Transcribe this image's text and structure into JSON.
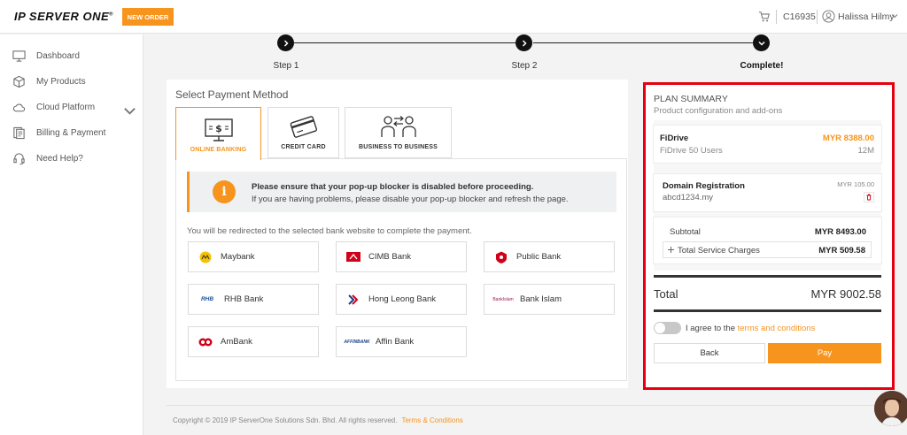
{
  "header": {
    "logo": "IP SERVER ONE",
    "logo_mark": "®",
    "new_order_label": "NEW ORDER",
    "client_id": "C16935",
    "user_name": "Halissa Hilmy"
  },
  "sidebar": {
    "items": [
      {
        "label": "Dashboard",
        "icon": "monitor-icon"
      },
      {
        "label": "My Products",
        "icon": "box-icon"
      },
      {
        "label": "Cloud Platform",
        "icon": "cloud-icon"
      },
      {
        "label": "Billing & Payment",
        "icon": "billing-icon"
      },
      {
        "label": "Need Help?",
        "icon": "headset-icon"
      }
    ]
  },
  "stepper": {
    "steps": [
      {
        "label": "Step 1"
      },
      {
        "label": "Step 2"
      },
      {
        "label": "Complete!"
      }
    ]
  },
  "payment": {
    "title": "Select Payment Method",
    "tabs": [
      {
        "label": "ONLINE BANKING",
        "active": true
      },
      {
        "label": "CREDIT CARD",
        "active": false
      },
      {
        "label": "BUSINESS TO BUSINESS",
        "active": false
      }
    ],
    "notice_title": "Please ensure that your pop-up blocker is disabled before proceeding.",
    "notice_body": "If you are having problems, please disable your pop-up blocker and refresh the page.",
    "redirect_text": "You will be redirected to the selected bank website to complete the payment.",
    "banks": [
      {
        "name": "Maybank",
        "logo_text": ""
      },
      {
        "name": "CIMB Bank",
        "logo_text": ""
      },
      {
        "name": "Public Bank",
        "logo_text": ""
      },
      {
        "name": "RHB Bank",
        "logo_text": "RHB"
      },
      {
        "name": "Hong Leong Bank",
        "logo_text": ""
      },
      {
        "name": "Bank Islam",
        "logo_text": "BankIslam"
      },
      {
        "name": "AmBank",
        "logo_text": ""
      },
      {
        "name": "Affin Bank",
        "logo_text": "AFFINBANK"
      }
    ]
  },
  "summary": {
    "title": "PLAN SUMMARY",
    "subtitle": "Product configuration and add-ons",
    "product_name": "FiDrive",
    "product_price": "MYR 8388.00",
    "product_desc": "FiDrive 50 Users",
    "product_term": "12M",
    "domain_label": "Domain Registration",
    "domain_price": "MYR 105.00",
    "domain_name": "abcd1234.my",
    "subtotal_label": "Subtotal",
    "subtotal_value": "MYR 8493.00",
    "service_label": "Total Service Charges",
    "service_value": "MYR 509.58",
    "total_label": "Total",
    "total_value": "MYR 9002.58",
    "agree_text": "I agree to the",
    "terms_link": "terms and conditions",
    "back_label": "Back",
    "pay_label": "Pay"
  },
  "footer": {
    "copyright": "Copyright © 2019 IP ServerOne Solutions Sdn. Bhd. All rights reserved.",
    "terms_link": "Terms & Conditions"
  },
  "colors": {
    "accent": "#f7941d",
    "highlight": "#e6000f"
  }
}
